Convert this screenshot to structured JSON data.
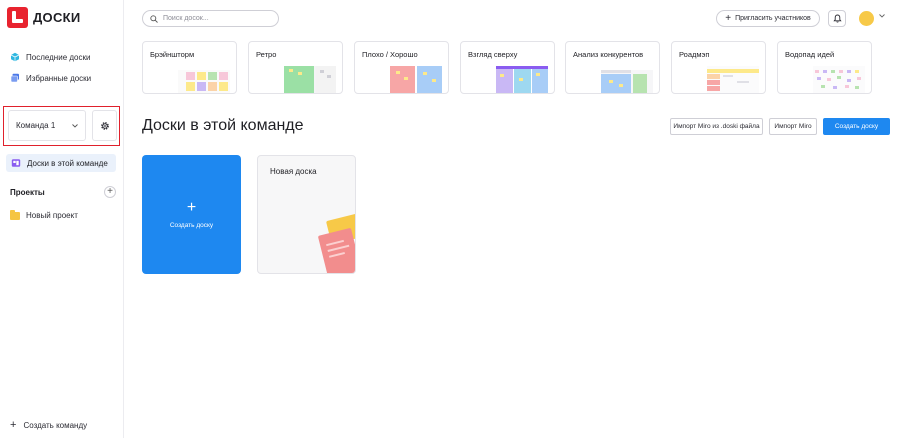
{
  "app": {
    "logo_text": "ДОСКИ"
  },
  "sidebar": {
    "recent_label": "Последние доски",
    "favorites_label": "Избранные доски",
    "team_name": "Команда 1",
    "team_boards_label": "Доски в этой команде",
    "projects_title": "Проекты",
    "project_name": "Новый проект",
    "create_team_label": "Создать команду"
  },
  "header": {
    "search_placeholder": "Поиск досок...",
    "invite_label": "Пригласить участников"
  },
  "templates": [
    {
      "label": "Брэйншторм"
    },
    {
      "label": "Ретро"
    },
    {
      "label": "Плохо / Хорошо"
    },
    {
      "label": "Взгляд сверху"
    },
    {
      "label": "Анализ конкурентов"
    },
    {
      "label": "Роадмэп"
    },
    {
      "label": "Водопад идей"
    }
  ],
  "main": {
    "title": "Доски в этой команде",
    "import_file_label": "Импорт Miro из .doski файла",
    "import_miro_label": "Импорт Miro",
    "create_board_label": "Создать доску",
    "create_card_label": "Создать доску",
    "create_card_plus": "+",
    "board_name": "Новая доска"
  },
  "colors": {
    "brand_red": "#e8232f",
    "accent_blue": "#1e88f0",
    "avatar_yellow": "#f7c948"
  }
}
